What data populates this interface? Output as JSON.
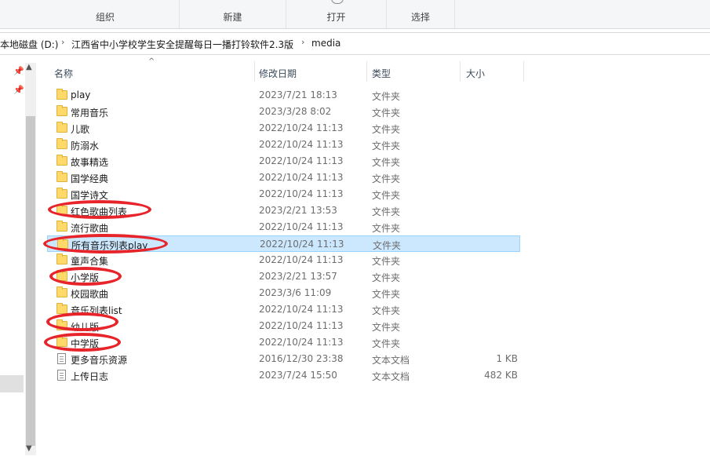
{
  "ribbon": {
    "groups": [
      {
        "label": "组织"
      },
      {
        "label": "新建"
      },
      {
        "label": "打开"
      },
      {
        "label": "选择"
      }
    ]
  },
  "address": {
    "crumbs": [
      "本地磁盘 (D:)",
      "江西省中小学校学生安全提醒每日一播打铃软件2.3版",
      "media"
    ],
    "separator": "›"
  },
  "columns": {
    "name": "名称",
    "date": "修改日期",
    "type": "类型",
    "size": "大小"
  },
  "files": [
    {
      "name": "play",
      "date": "2023/7/21 18:13",
      "type": "文件夹",
      "size": "",
      "icon": "folder-icon"
    },
    {
      "name": "常用音乐",
      "date": "2023/3/28 8:02",
      "type": "文件夹",
      "size": "",
      "icon": "folder-icon"
    },
    {
      "name": "儿歌",
      "date": "2022/10/24 11:13",
      "type": "文件夹",
      "size": "",
      "icon": "folder-icon"
    },
    {
      "name": "防溺水",
      "date": "2022/10/24 11:13",
      "type": "文件夹",
      "size": "",
      "icon": "folder-icon"
    },
    {
      "name": "故事精选",
      "date": "2022/10/24 11:13",
      "type": "文件夹",
      "size": "",
      "icon": "folder-icon"
    },
    {
      "name": "国学经典",
      "date": "2022/10/24 11:13",
      "type": "文件夹",
      "size": "",
      "icon": "folder-icon"
    },
    {
      "name": "国学诗文",
      "date": "2022/10/24 11:13",
      "type": "文件夹",
      "size": "",
      "icon": "folder-icon"
    },
    {
      "name": "红色歌曲列表",
      "date": "2023/2/21 13:53",
      "type": "文件夹",
      "size": "",
      "icon": "folder-icon"
    },
    {
      "name": "流行歌曲",
      "date": "2022/10/24 11:13",
      "type": "文件夹",
      "size": "",
      "icon": "folder-icon"
    },
    {
      "name": "所有音乐列表play",
      "date": "2022/10/24 11:13",
      "type": "文件夹",
      "size": "",
      "icon": "folder-icon",
      "selected": true
    },
    {
      "name": "童声合集",
      "date": "2022/10/24 11:13",
      "type": "文件夹",
      "size": "",
      "icon": "folder-icon"
    },
    {
      "name": "小学版",
      "date": "2023/2/21 13:57",
      "type": "文件夹",
      "size": "",
      "icon": "folder-icon"
    },
    {
      "name": "校园歌曲",
      "date": "2023/3/6 11:09",
      "type": "文件夹",
      "size": "",
      "icon": "folder-icon"
    },
    {
      "name": "音乐列表list",
      "date": "2022/10/24 11:13",
      "type": "文件夹",
      "size": "",
      "icon": "folder-icon"
    },
    {
      "name": "幼儿版",
      "date": "2022/10/24 11:13",
      "type": "文件夹",
      "size": "",
      "icon": "folder-icon"
    },
    {
      "name": "中学版",
      "date": "2022/10/24 11:13",
      "type": "文件夹",
      "size": "",
      "icon": "folder-icon"
    },
    {
      "name": "更多音乐资源",
      "date": "2016/12/30 23:38",
      "type": "文本文档",
      "size": "1 KB",
      "icon": "text-document-icon"
    },
    {
      "name": "上传日志",
      "date": "2023/7/24 15:50",
      "type": "文本文档",
      "size": "482 KB",
      "icon": "text-document-icon"
    }
  ],
  "annotation_color": "#e8242b",
  "selection_color": "#cce8ff"
}
